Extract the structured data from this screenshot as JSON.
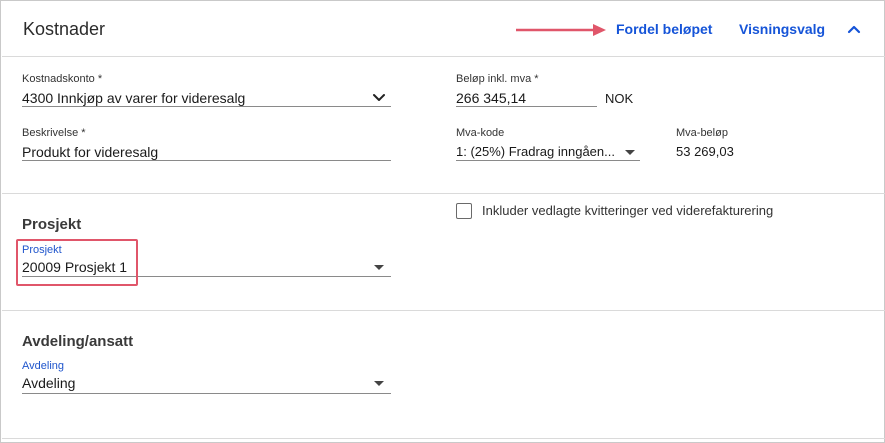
{
  "header": {
    "title": "Kostnader",
    "fordel_label": "Fordel beløpet",
    "visning_label": "Visningsvalg"
  },
  "colors": {
    "link": "#1554d8",
    "annotation_arrow": "#e0566a",
    "highlight_box": "#e0566a"
  },
  "fields": {
    "kostnadskonto": {
      "label": "Kostnadskonto *",
      "value": "4300 Innkjøp av varer for videresalg"
    },
    "belop": {
      "label": "Beløp inkl. mva *",
      "value": "266 345,14",
      "currency": "NOK"
    },
    "beskrivelse": {
      "label": "Beskrivelse *",
      "value": "Produkt for videresalg"
    },
    "mva_kode": {
      "label": "Mva-kode",
      "value": "1: (25%) Fradrag inngåen..."
    },
    "mva_belop": {
      "label": "Mva-beløp",
      "value": "53 269,03"
    }
  },
  "prosjekt_section": {
    "title": "Prosjekt",
    "checkbox_label": "Inkluder vedlagte kvitteringer ved viderefakturering",
    "checkbox_checked": false,
    "field": {
      "label": "Prosjekt",
      "value": "20009 Prosjekt 1"
    }
  },
  "avdeling_section": {
    "title": "Avdeling/ansatt",
    "field": {
      "label": "Avdeling",
      "value": "Avdeling"
    }
  },
  "icons": {
    "collapse": "chevron-up-icon",
    "kostnadskonto_dropdown": "chevron-down-icon",
    "select_caret": "caret-down-icon"
  }
}
